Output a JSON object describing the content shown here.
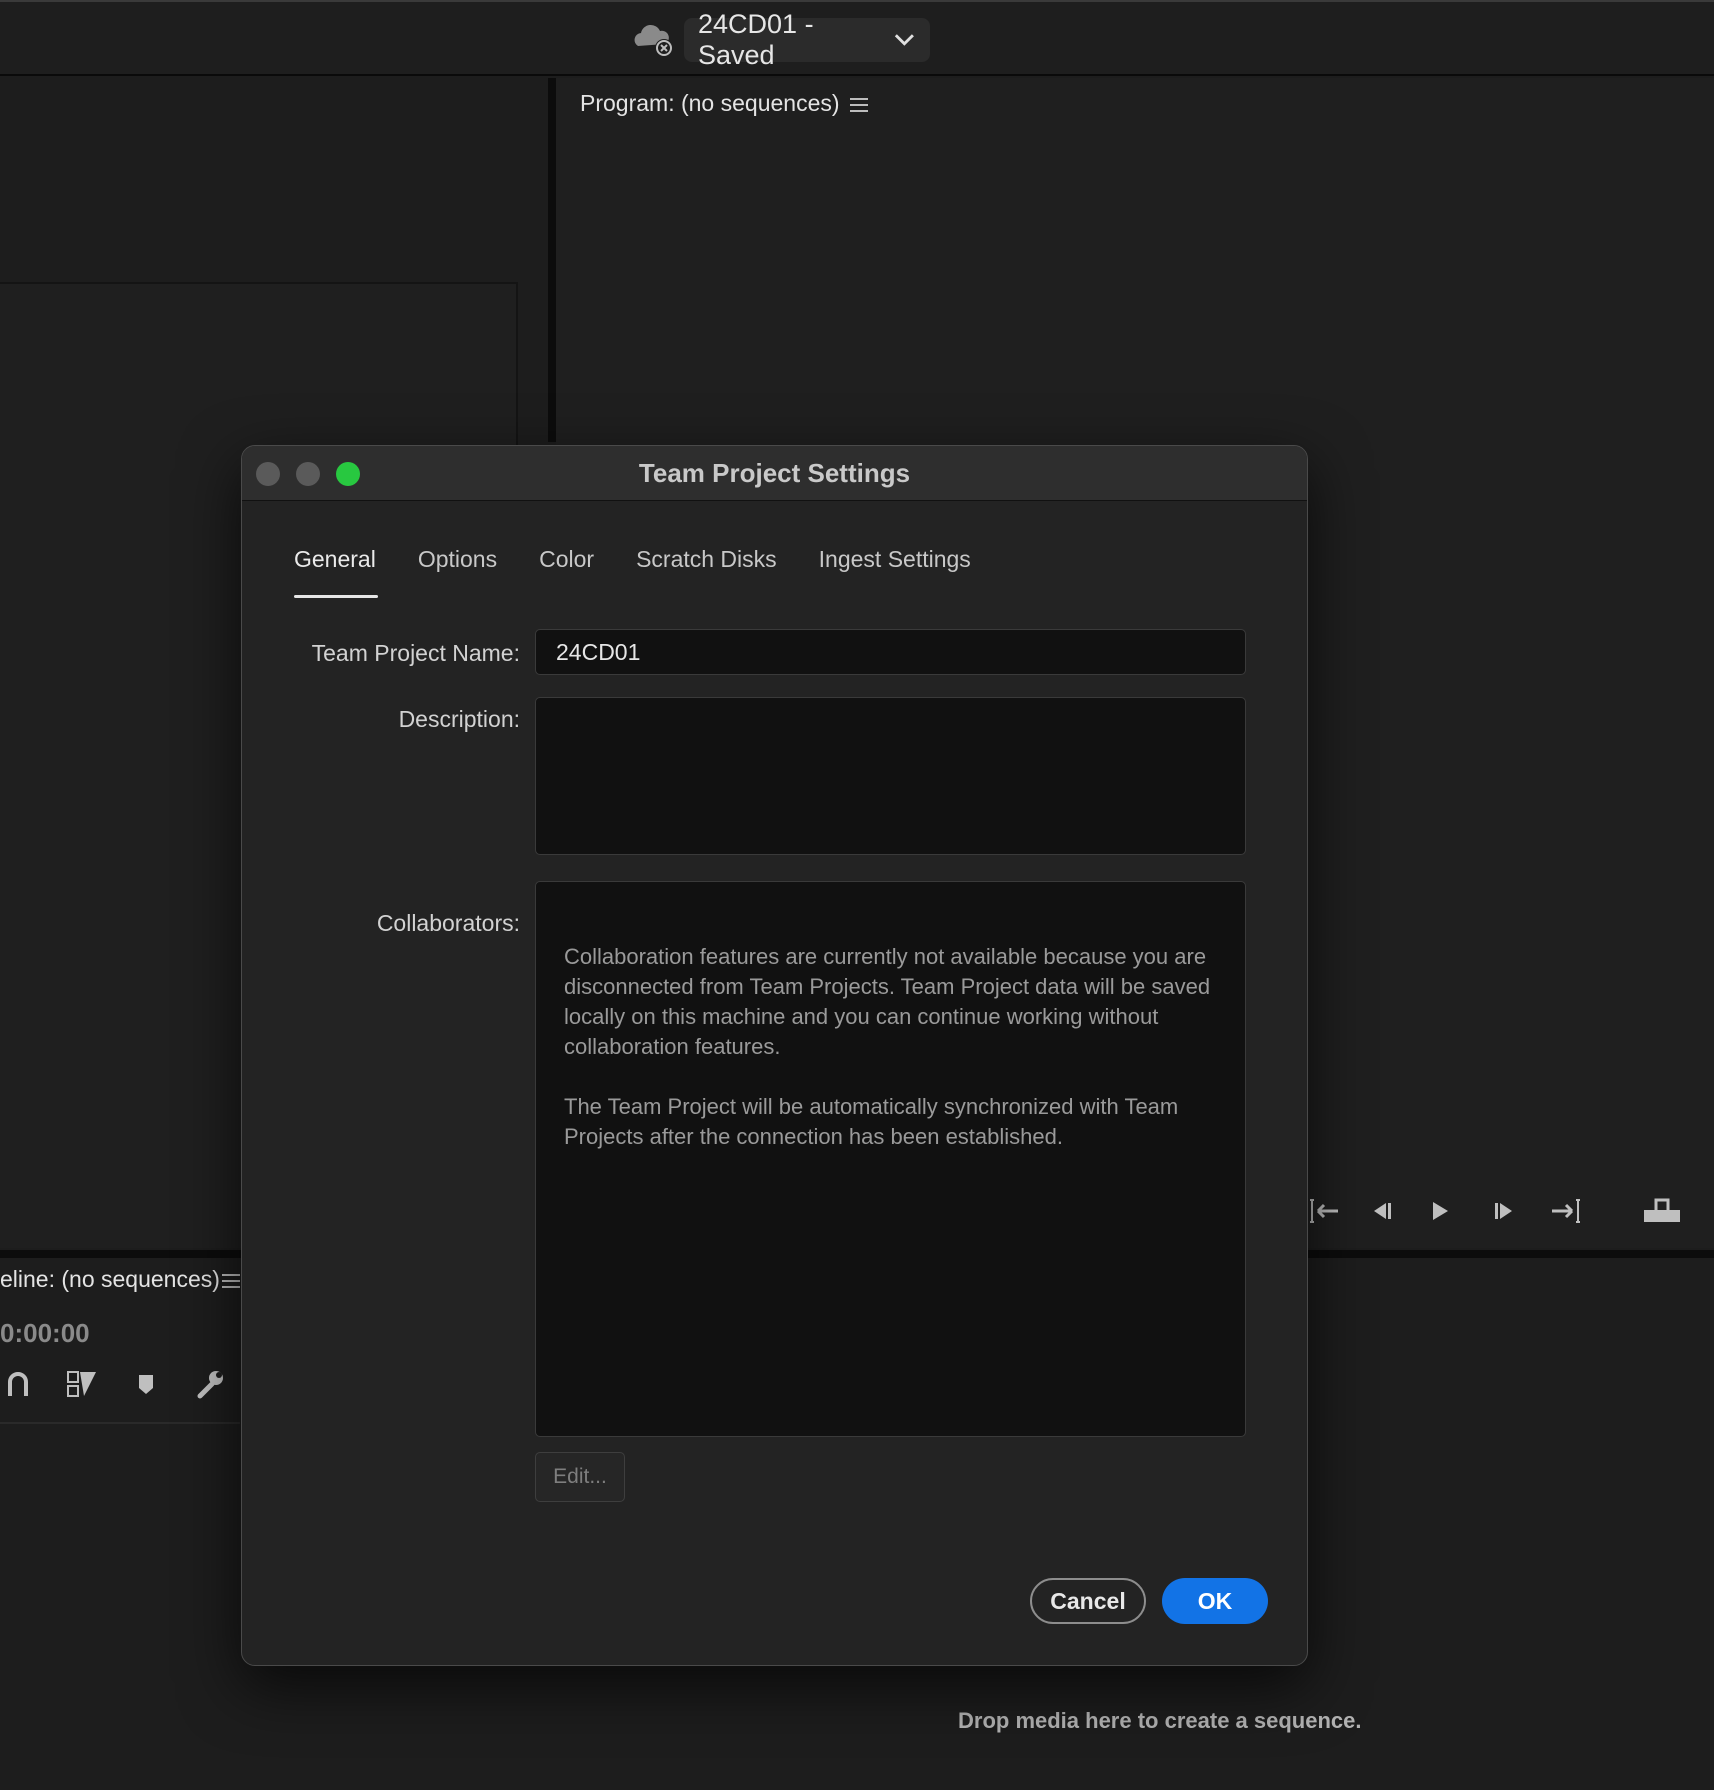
{
  "topbar": {
    "project_title": "24CD01 - Saved",
    "cloud_status_icon": "cloud-disconnected-icon"
  },
  "program_panel": {
    "title": "Program: (no sequences)"
  },
  "timeline_panel": {
    "title": "eline: (no sequences)",
    "timecode": "0:00:00",
    "drop_text": "Drop media here to create a sequence."
  },
  "dialog": {
    "title": "Team Project Settings",
    "tabs": [
      {
        "label": "General",
        "active": true
      },
      {
        "label": "Options",
        "active": false
      },
      {
        "label": "Color",
        "active": false
      },
      {
        "label": "Scratch Disks",
        "active": false
      },
      {
        "label": "Ingest Settings",
        "active": false
      }
    ],
    "fields": {
      "name_label": "Team Project Name:",
      "name_value": "24CD01",
      "description_label": "Description:",
      "description_value": "",
      "collaborators_label": "Collaborators:"
    },
    "collaborators_message": [
      "Collaboration features are currently not available because you are disconnected from Team Projects. Team Project data will be saved locally on this machine and you can continue working without collaboration features.",
      "The Team Project will be automatically synchronized with Team Projects after the connection has been established."
    ],
    "buttons": {
      "edit": "Edit...",
      "cancel": "Cancel",
      "ok": "OK"
    }
  },
  "colors": {
    "accent": "#1273e6",
    "traffic_close": "#5a5a5a",
    "traffic_minimize": "#5a5a5a",
    "traffic_zoom": "#28c840"
  }
}
